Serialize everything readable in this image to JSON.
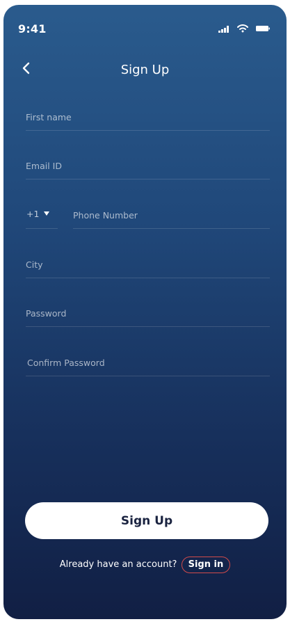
{
  "status_bar": {
    "time": "9:41"
  },
  "header": {
    "title": "Sign Up"
  },
  "form": {
    "first_name_placeholder": "First name",
    "email_placeholder": "Email ID",
    "country_code": "+1",
    "phone_placeholder": "Phone Number",
    "city_placeholder": "City",
    "password_placeholder": "Password",
    "confirm_password_placeholder": "Confirm Password"
  },
  "actions": {
    "sign_up_label": "Sign Up",
    "have_account_text": "Already have an account?",
    "sign_in_label": "Sign in"
  },
  "theme": {
    "gradient_top": "#2a5b8d",
    "gradient_bottom": "#111f44",
    "accent_outline": "#d24b4b"
  },
  "icons": {
    "back": "chevron-left-icon",
    "signal": "signal-icon",
    "wifi": "wifi-icon",
    "battery": "battery-icon",
    "dropdown": "caret-down-icon"
  }
}
